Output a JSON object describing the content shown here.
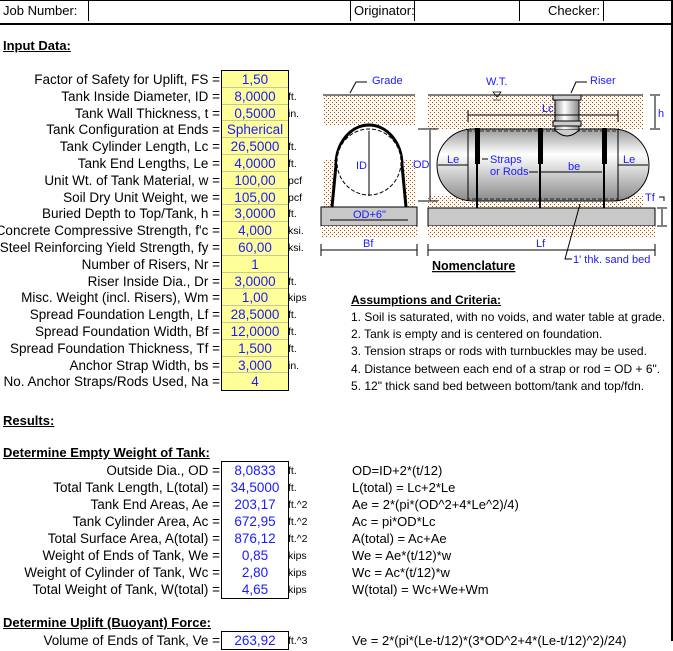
{
  "header": {
    "job_number_label": "Job Number:",
    "job_number_value": "",
    "originator_label": "Originator:",
    "originator_value": "",
    "checker_label": "Checker:",
    "checker_value": ""
  },
  "input_section": {
    "title": "Input Data:",
    "rows": [
      {
        "label": "Factor of Safety for Uplift, FS =",
        "value": "1,50",
        "unit": ""
      },
      {
        "label": "Tank Inside Diameter, ID =",
        "value": "8,0000",
        "unit": "ft."
      },
      {
        "label": "Tank Wall Thickness, t =",
        "value": "0,5000",
        "unit": "in."
      },
      {
        "label": "Tank Configuration at Ends =",
        "value": "Spherical",
        "unit": ""
      },
      {
        "label": "Tank Cylinder Length, Lc =",
        "value": "26,5000",
        "unit": "ft."
      },
      {
        "label": "Tank End Lengths, Le =",
        "value": "4,0000",
        "unit": "ft."
      },
      {
        "label": "Unit Wt. of Tank Material, w =",
        "value": "100,00",
        "unit": "pcf"
      },
      {
        "label": "Soil Dry Unit Weight, we =",
        "value": "105,00",
        "unit": "pcf"
      },
      {
        "label": "Buried Depth to Top/Tank, h =",
        "value": "3,0000",
        "unit": "ft."
      },
      {
        "label": "Concrete Compressive Strength, f'c =",
        "value": "4,000",
        "unit": "ksi."
      },
      {
        "label": "Steel Reinforcing Yield Strength, fy =",
        "value": "60,00",
        "unit": "ksi."
      },
      {
        "label": "Number of Risers, Nr =",
        "value": "1",
        "unit": ""
      },
      {
        "label": "Riser Inside Dia., Dr =",
        "value": "3,0000",
        "unit": "ft."
      },
      {
        "label": "Misc. Weight (incl. Risers), Wm =",
        "value": "1,00",
        "unit": "kips"
      },
      {
        "label": "Spread Foundation Length, Lf =",
        "value": "28,5000",
        "unit": "ft."
      },
      {
        "label": "Spread Foundation Width, Bf =",
        "value": "12,0000",
        "unit": "ft."
      },
      {
        "label": "Spread Foundation Thickness, Tf =",
        "value": "1,500",
        "unit": "ft."
      },
      {
        "label": "Anchor Strap Width, bs =",
        "value": "3,000",
        "unit": "in."
      },
      {
        "label": "No. Anchor Straps/Rods Used, Na =",
        "value": "4",
        "unit": ""
      }
    ]
  },
  "diagram": {
    "grade": "Grade",
    "wt": "W.T.",
    "riser": "Riser",
    "lc": "Lc",
    "h": "h",
    "id": "ID",
    "od": "OD",
    "le_left": "Le",
    "le_right": "Le",
    "straps": "Straps",
    "or_rods": "or Rods",
    "be": "be",
    "tf": "Tf",
    "od6": "OD+6\"",
    "bf": "Bf",
    "lf": "Lf",
    "sand_bed": "1' thk. sand bed",
    "caption": "Nomenclature"
  },
  "assumptions": {
    "title": "Assumptions and Criteria:",
    "items": [
      "1. Soil is saturated, with no voids, and water table at grade.",
      "2. Tank is empty and is centered on foundation.",
      "3. Tension straps or rods with turnbuckles may be used.",
      "4. Distance between each end of a strap or rod = OD + 6\".",
      "5. 12\" thick sand bed between bottom/tank and top/fdn."
    ]
  },
  "results": {
    "title": "Results:",
    "empty_weight": {
      "title": "Determine Empty Weight of Tank:",
      "rows": [
        {
          "label": "Outside Dia., OD =",
          "value": "8,0833",
          "unit": "ft.",
          "formula": "OD=ID+2*(t/12)"
        },
        {
          "label": "Total Tank Length, L(total) =",
          "value": "34,5000",
          "unit": "ft.",
          "formula": "L(total) = Lc+2*Le"
        },
        {
          "label": "Tank End Areas, Ae =",
          "value": "203,17",
          "unit": "ft.^2",
          "formula": "Ae = 2*(pi*(OD^2+4*Le^2)/4)"
        },
        {
          "label": "Tank Cylinder Area, Ac =",
          "value": "672,95",
          "unit": "ft.^2",
          "formula": "Ac = pi*OD*Lc"
        },
        {
          "label": "Total Surface Area, A(total) =",
          "value": "876,12",
          "unit": "ft.^2",
          "formula": "A(total) = Ac+Ae"
        },
        {
          "label": "Weight of Ends of Tank, We =",
          "value": "0,85",
          "unit": "kips",
          "formula": "We = Ae*(t/12)*w"
        },
        {
          "label": "Weight of Cylinder of Tank, Wc =",
          "value": "2,80",
          "unit": "kips",
          "formula": "Wc = Ac*(t/12)*w"
        },
        {
          "label": "Total Weight of Tank, W(total) =",
          "value": "4,65",
          "unit": "kips",
          "formula": "W(total) = Wc+We+Wm"
        }
      ]
    },
    "uplift": {
      "title": "Determine Uplift (Buoyant) Force:",
      "rows": [
        {
          "label": "Volume of Ends of Tank, Ve =",
          "value": "263,92",
          "unit": "ft.^3",
          "formula": "Ve = 2*(pi*(Le-t/12)*(3*OD^2+4*(Le-t/12)^2)/24)"
        }
      ]
    }
  },
  "colors": {
    "input_fill": "#ffff99",
    "value_text": "#1a1aff",
    "soil": "#a0522d",
    "foundation": "#c8c8c8"
  }
}
